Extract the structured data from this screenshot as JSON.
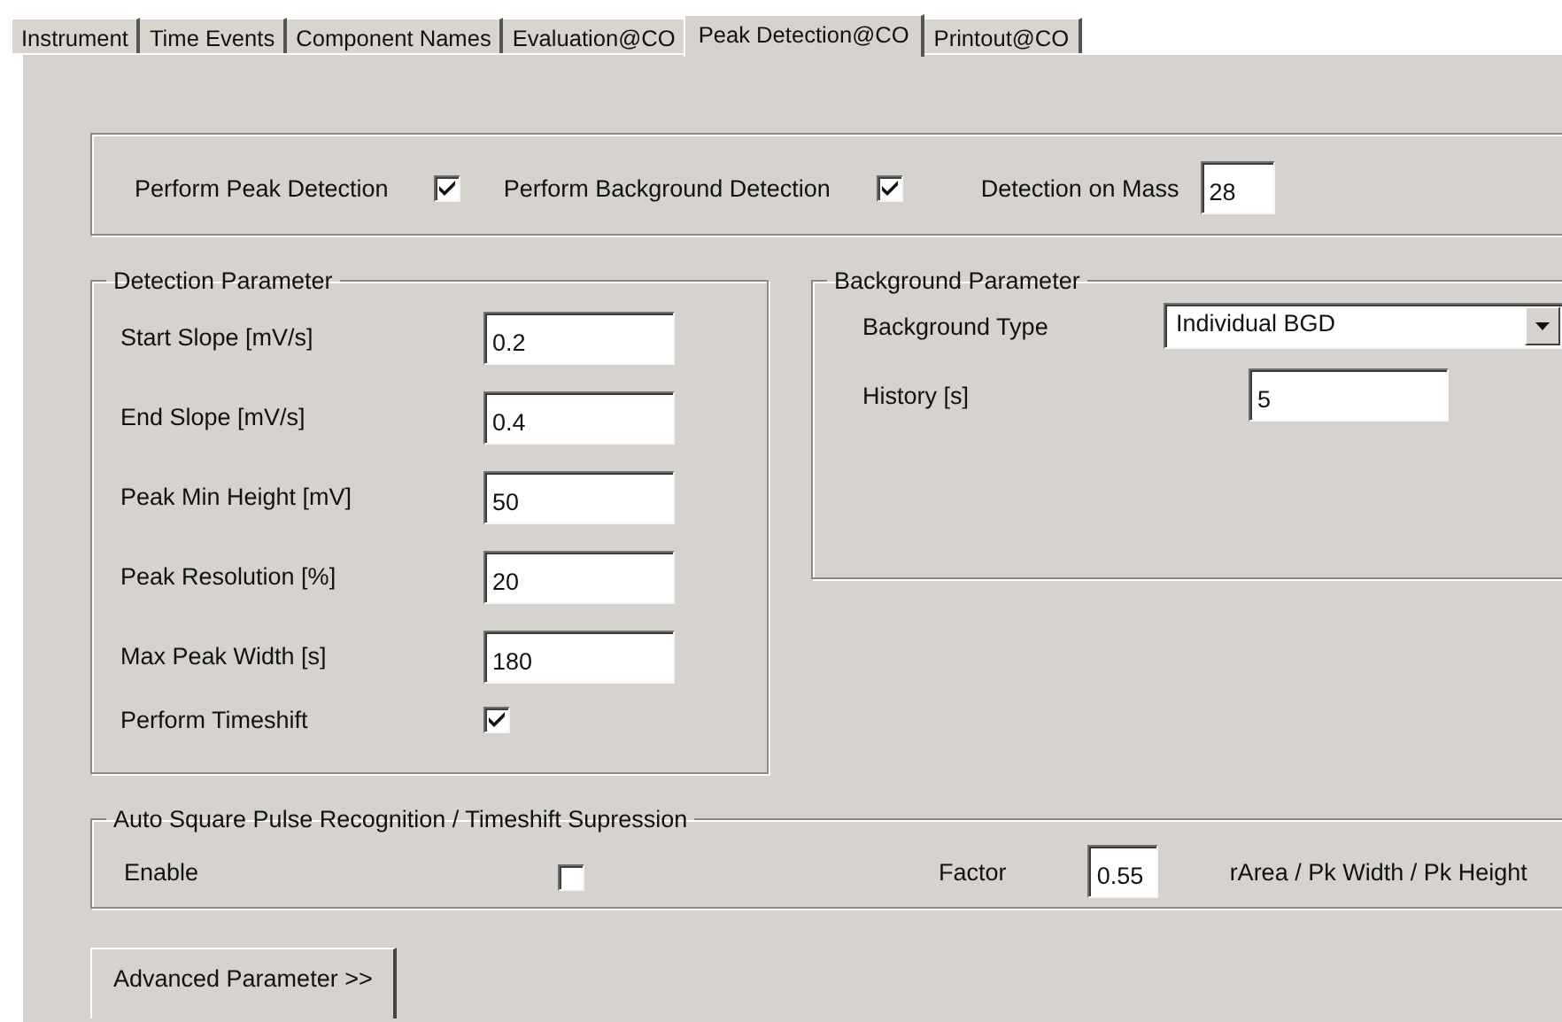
{
  "tabs": [
    {
      "label": "Instrument",
      "selected": false
    },
    {
      "label": "Time Events",
      "selected": false
    },
    {
      "label": "Component Names",
      "selected": false
    },
    {
      "label": "Evaluation@CO",
      "selected": false
    },
    {
      "label": "Peak Detection@CO",
      "selected": true
    },
    {
      "label": "Printout@CO",
      "selected": false
    }
  ],
  "options_bar": {
    "items": [
      {
        "kind": "checkbox",
        "label": "Perform Peak Detection",
        "checked": true
      },
      {
        "kind": "checkbox",
        "label": "Perform Background Detection",
        "checked": true
      },
      {
        "kind": "field",
        "label": "Detection on Mass",
        "value": "28"
      }
    ]
  },
  "detection_parameter": {
    "title": "Detection Parameter",
    "rows": [
      {
        "kind": "field",
        "label": "Start Slope [mV/s]",
        "value": "0.2"
      },
      {
        "kind": "field",
        "label": "End Slope [mV/s]",
        "value": "0.4"
      },
      {
        "kind": "field",
        "label": "Peak Min Height [mV]",
        "value": "50"
      },
      {
        "kind": "field",
        "label": "Peak Resolution [%]",
        "value": "20"
      },
      {
        "kind": "field",
        "label": "Max Peak Width [s]",
        "value": "180"
      },
      {
        "kind": "checkbox",
        "label": "Perform Timeshift",
        "checked": true
      }
    ]
  },
  "background_parameter": {
    "title": "Background Parameter",
    "rows": [
      {
        "kind": "dropdown",
        "label": "Background Type",
        "value": "Individual BGD"
      },
      {
        "kind": "field",
        "label": "History [s]",
        "value": "5"
      }
    ]
  },
  "square_pulse": {
    "title": "Auto Square Pulse Recognition / Timeshift Supression",
    "items": [
      {
        "kind": "checkbox",
        "label": "Enable",
        "checked": false
      },
      {
        "kind": "field",
        "label": "Factor",
        "value": "0.55"
      },
      {
        "kind": "text",
        "label": "rArea / Pk Width / Pk Height"
      }
    ]
  },
  "advanced_button": "Advanced Parameter >>"
}
